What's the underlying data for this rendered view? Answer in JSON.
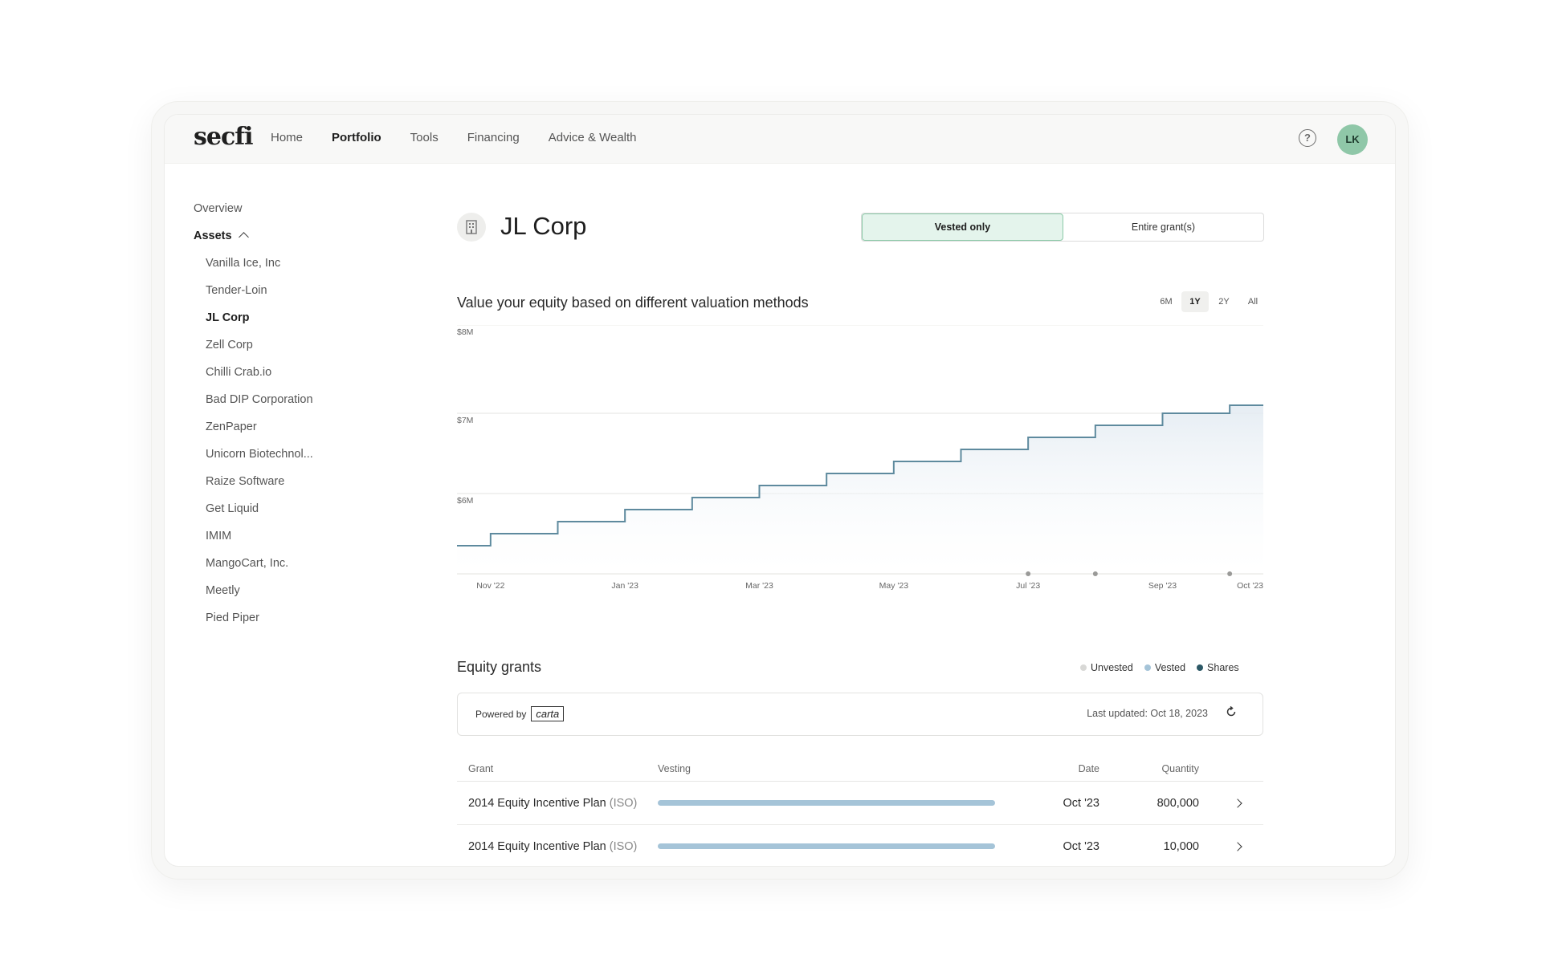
{
  "app": {
    "logo": "secfi"
  },
  "nav": {
    "links": [
      "Home",
      "Portfolio",
      "Tools",
      "Financing",
      "Advice & Wealth"
    ],
    "active": "Portfolio",
    "help_icon": "?",
    "avatar_initials": "LK"
  },
  "sidebar": {
    "overview": "Overview",
    "assets_label": "Assets",
    "assets": [
      "Vanilla Ice, Inc",
      "Tender-Loin",
      "JL Corp",
      "Zell Corp",
      "Chilli Crab.io",
      "Bad DIP Corporation",
      "ZenPaper",
      "Unicorn Biotechnol...",
      "Raize Software",
      "Get Liquid",
      "IMIM",
      "MangoCart, Inc.",
      "Meetly",
      "Pied Piper"
    ],
    "selected": "JL Corp"
  },
  "company": {
    "name": "JL Corp",
    "icon": "building-icon"
  },
  "toggle": {
    "options": [
      "Vested only",
      "Entire grant(s)"
    ],
    "active": "Vested only"
  },
  "valuation": {
    "heading": "Value your equity based on different valuation methods",
    "ranges": [
      "6M",
      "1Y",
      "2Y",
      "All"
    ],
    "active_range": "1Y"
  },
  "chart_data": {
    "type": "area",
    "step": true,
    "y_tick_labels": [
      "$6M",
      "$7M",
      "$8M"
    ],
    "ylim": [
      5.0,
      8.0
    ],
    "x_tick_labels": [
      "Nov '22",
      "Jan '23",
      "Mar '23",
      "May '23",
      "Jul '23",
      "Sep '23",
      "Oct '23"
    ],
    "x_ticks": [
      0.5,
      2.5,
      4.5,
      6.5,
      8.5,
      10.5,
      11.5
    ],
    "xlim": [
      0,
      12
    ],
    "series": [
      {
        "x": [
          0,
          0.5,
          1.5,
          2.5,
          3.5,
          4.5,
          5.5,
          6.5,
          7.5,
          8.5,
          9.5,
          10.5,
          11.5,
          12
        ],
        "values": [
          5.35,
          5.5,
          5.65,
          5.8,
          5.95,
          6.1,
          6.25,
          6.4,
          6.55,
          6.7,
          6.85,
          7.0,
          7.1,
          7.1
        ]
      }
    ],
    "markers_x": [
      8.5,
      9.5,
      11.5
    ],
    "grid": true,
    "colors": {
      "line": "#5e8a9e",
      "fill_top": "#e3ebf2"
    }
  },
  "equity": {
    "heading": "Equity grants",
    "legend": [
      {
        "label": "Unvested",
        "color": "#d8d8d6"
      },
      {
        "label": "Vested",
        "color": "#a5c4d8"
      },
      {
        "label": "Shares",
        "color": "#2c5866"
      }
    ],
    "powered_by": "Powered by",
    "powered_brand": "carta",
    "last_updated": "Last updated: Oct 18, 2023",
    "columns": {
      "grant": "Grant",
      "vesting": "Vesting",
      "date": "Date",
      "quantity": "Quantity"
    },
    "rows": [
      {
        "plan": "2014 Equity Incentive Plan",
        "type": "(ISO)",
        "date": "Oct '23",
        "quantity": "800,000",
        "vested_fraction": 1.0
      },
      {
        "plan": "2014 Equity Incentive Plan",
        "type": "(ISO)",
        "date": "Oct '23",
        "quantity": "10,000",
        "vested_fraction": 1.0
      }
    ]
  }
}
